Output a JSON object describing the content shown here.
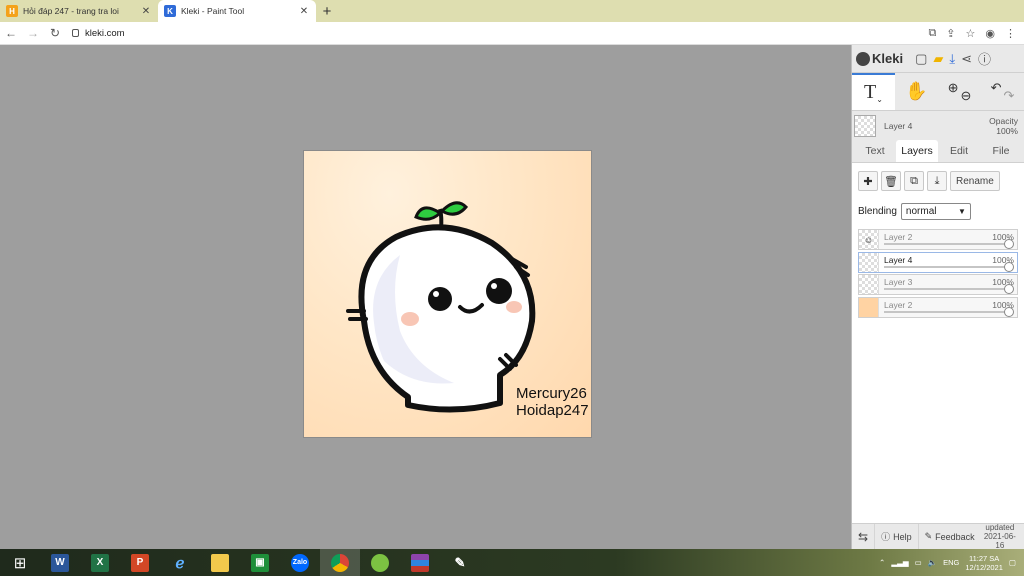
{
  "browser": {
    "tabs": [
      {
        "title": "Hỏi đáp 247 - trang tra loi",
        "active": false,
        "favicon": "hoidap-favicon"
      },
      {
        "title": "Kleki - Paint Tool",
        "active": true,
        "favicon": "kleki-favicon"
      }
    ],
    "new_tab": "+",
    "url": "kleki.com"
  },
  "canvas": {
    "watermark_line1": "Mercury26",
    "watermark_line2": "Hoidap247"
  },
  "panel": {
    "logo": "Kleki",
    "current_layer": "Layer 4",
    "opacity_label": "Opacity",
    "opacity_value": "100%",
    "tabs": [
      "Text",
      "Layers",
      "Edit",
      "File"
    ],
    "active_tab": "Layers",
    "rename_label": "Rename",
    "blending_label": "Blending",
    "blending_value": "normal",
    "layers": [
      {
        "name": "Layer 2",
        "opacity": "100%",
        "thumb": "drawing",
        "active": false
      },
      {
        "name": "Layer 4",
        "opacity": "100%",
        "thumb": "transparent",
        "active": true
      },
      {
        "name": "Layer 3",
        "opacity": "100%",
        "thumb": "transparent",
        "active": false
      },
      {
        "name": "Layer 2",
        "opacity": "100%",
        "thumb": "peach",
        "active": false
      }
    ],
    "help_label": "Help",
    "feedback_label": "Feedback",
    "updated_label": "updated",
    "updated_date": "2021-06-16"
  },
  "taskbar": {
    "lang": "ENG",
    "time": "11:27 SA",
    "date": "12/12/2021"
  },
  "colors": {
    "accent": "#3a7bd5",
    "artboard_bg": "#ffe6c6",
    "sprout_green": "#2ecc40"
  }
}
